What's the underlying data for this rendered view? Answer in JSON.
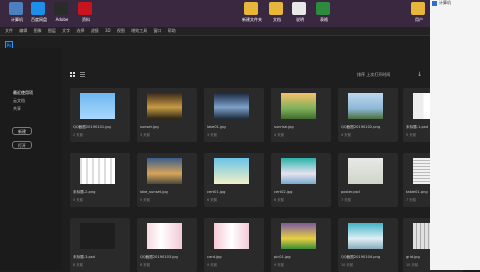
{
  "desktop": {
    "icons": [
      {
        "label": "计算机",
        "color": "#4a7fc0",
        "icon": "computer-icon"
      },
      {
        "label": "百度网盘",
        "color": "#1e8fe8",
        "icon": "baidu-netdisk-icon"
      },
      {
        "label": "Adobe",
        "color": "#2b2b2b",
        "icon": "adobe-app-icon"
      },
      {
        "label": "资料",
        "color": "#c8141e",
        "icon": "red-folder-icon"
      },
      {
        "label": "新建文件夹",
        "color": "#e8b63a",
        "icon": "folder-icon"
      },
      {
        "label": "文档",
        "color": "#e8b63a",
        "icon": "folder-icon"
      },
      {
        "label": "说明",
        "color": "#e8e8e8",
        "icon": "document-icon"
      },
      {
        "label": "表格",
        "color": "#2e8b3e",
        "icon": "excel-icon"
      },
      {
        "label": "用户",
        "color": "#e8b63a",
        "icon": "folder-icon"
      }
    ]
  },
  "menubar": {
    "items": [
      "文件",
      "编辑",
      "图像",
      "图层",
      "文字",
      "选择",
      "滤镜",
      "3D",
      "视图",
      "增效工具",
      "窗口",
      "帮助"
    ]
  },
  "app": {
    "logo": "Ps",
    "sidebar": {
      "section_title": "最近使用项",
      "items": [
        "云文档",
        "共享"
      ],
      "new_button": "新建",
      "open_button": "打开"
    },
    "sort_label": "排序  上次打开时间",
    "files": [
      {
        "name": "QQ截图20190101.jpg",
        "sub": "2 天前"
      },
      {
        "name": "sunset.jpg",
        "sub": "3 天前"
      },
      {
        "name": "lake01.jpg",
        "sub": "3 天前"
      },
      {
        "name": "sunrise.jpg",
        "sub": "4 天前"
      },
      {
        "name": "QQ截图20190102.png",
        "sub": "4 天前"
      },
      {
        "name": "未标题-1.psd",
        "sub": "5 天前"
      },
      {
        "name": "未标题-2.png",
        "sub": "5 天前"
      },
      {
        "name": "lake_sunset.jpg",
        "sub": "5 天前"
      },
      {
        "name": "cert01.jpg",
        "sub": "6 天前"
      },
      {
        "name": "cert02.jpg",
        "sub": "6 天前"
      },
      {
        "name": "poster.psd",
        "sub": "7 天前"
      },
      {
        "name": "table01.png",
        "sub": "7 天前"
      },
      {
        "name": "未标题-3.psd",
        "sub": "8 天前"
      },
      {
        "name": "QQ截图20190103.jpg",
        "sub": "8 天前"
      },
      {
        "name": "card.jpg",
        "sub": "9 天前"
      },
      {
        "name": "pic01.jpg",
        "sub": "9 天前"
      },
      {
        "name": "QQ截图20190104.png",
        "sub": "10 天前"
      },
      {
        "name": "grid.jpg",
        "sub": "10 天前"
      }
    ]
  },
  "right_panel": {
    "title": "计算机"
  },
  "colors": {
    "desktop_bg": "#3a2740",
    "app_bg": "#1e1e1e",
    "tile_bg": "#2a2a2a",
    "ps_blue": "#31a8ff"
  }
}
